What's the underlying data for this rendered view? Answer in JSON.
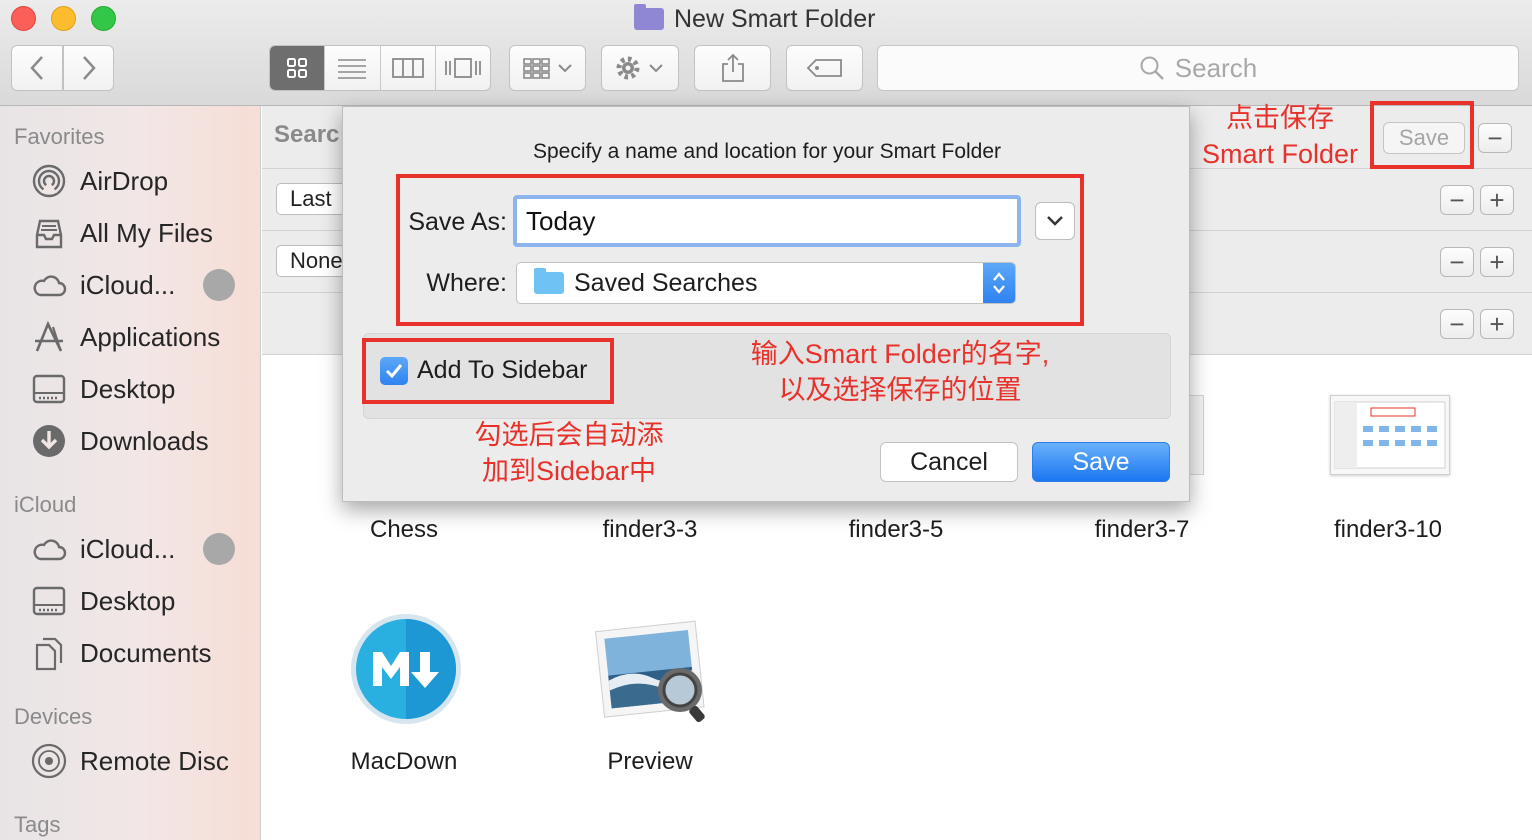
{
  "window": {
    "title": "New Smart Folder"
  },
  "toolbar": {
    "search_placeholder": "Search"
  },
  "sidebar": {
    "sections": {
      "favorites": "Favorites",
      "icloud": "iCloud",
      "devices": "Devices",
      "tags": "Tags"
    },
    "favorites": [
      "AirDrop",
      "All My Files",
      "iCloud...",
      "Applications",
      "Desktop",
      "Downloads"
    ],
    "icloud": [
      "iCloud...",
      "Desktop",
      "Documents"
    ],
    "devices": [
      "Remote Disc"
    ]
  },
  "criteria": {
    "search_label": "Searc",
    "row1_select": "Last",
    "row2_select": "None",
    "save_button": "Save",
    "minus": "−",
    "plus": "+"
  },
  "files": [
    "Chess",
    "finder3-3",
    "finder3-5",
    "finder3-7",
    "finder3-10",
    "MacDown",
    "Preview"
  ],
  "dialog": {
    "prompt": "Specify a name and location for your Smart Folder",
    "save_as_label": "Save As:",
    "save_as_value": "Today",
    "where_label": "Where:",
    "where_value": "Saved Searches",
    "add_to_sidebar": "Add To Sidebar",
    "add_to_sidebar_checked": true,
    "cancel": "Cancel",
    "save": "Save"
  },
  "annotations": {
    "save_note_line1": "点击保存",
    "save_note_line2": "Smart Folder",
    "name_note_line1": "输入Smart Folder的名字,",
    "name_note_line2": "以及选择保存的位置",
    "sidebar_note_line1": "勾选后会自动添",
    "sidebar_note_line2": "加到Sidebar中",
    "color": "#e8312a"
  }
}
